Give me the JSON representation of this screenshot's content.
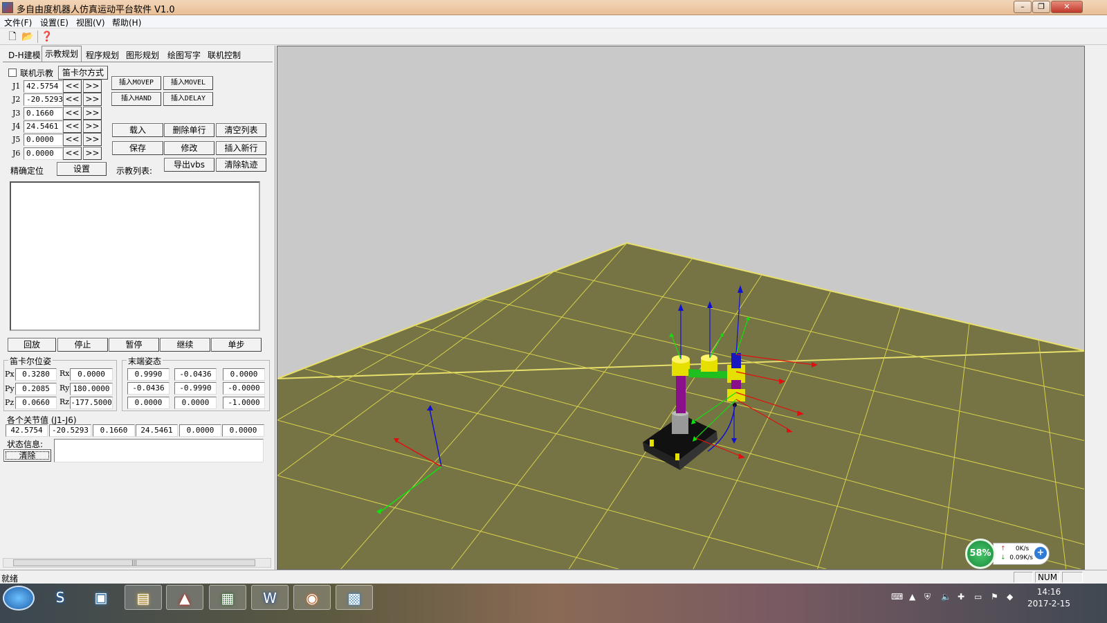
{
  "window": {
    "title": "多自由度机器人仿真运动平台软件 V1.0",
    "controls": {
      "minimize": "–",
      "restore": "❐",
      "close": "✕"
    }
  },
  "menu": [
    "文件(F)",
    "设置(E)",
    "视图(V)",
    "帮助(H)"
  ],
  "toolbar": {
    "icons": [
      "new-file-icon",
      "open-folder-icon",
      "help-icon"
    ],
    "glyphs": [
      "🗋",
      "📂",
      "❓"
    ]
  },
  "tabs": [
    "D-H建模",
    "示教规划",
    "程序规划",
    "图形规划",
    "绘图写字",
    "联机控制"
  ],
  "active_tab": "示教规划",
  "teach": {
    "online_checkbox_label": "联机示教",
    "cartesian_button": "笛卡尔方式",
    "joints": [
      {
        "label": "J1",
        "value": "42.5754"
      },
      {
        "label": "J2",
        "value": "-20.5293"
      },
      {
        "label": "J3",
        "value": "0.1660"
      },
      {
        "label": "J4",
        "value": "24.5461"
      },
      {
        "label": "J5",
        "value": "0.0000"
      },
      {
        "label": "J6",
        "value": "0.0000"
      }
    ],
    "dec_label": "<<",
    "inc_label": ">>",
    "precise_label": "精确定位",
    "set_button": "设置",
    "insert_buttons": [
      "插入MOVEP",
      "插入MOVEL",
      "插入HAND",
      "插入DELAY"
    ],
    "list_buttons": [
      "载入",
      "删除单行",
      "清空列表",
      "保存",
      "修改",
      "插入新行"
    ],
    "teach_list_label": "示教列表:",
    "export_button": "导出vbs",
    "clear_track_button": "清除轨迹"
  },
  "playback_buttons": [
    "回放",
    "停止",
    "暂停",
    "继续",
    "单步"
  ],
  "cartesian": {
    "title": "笛卡尔位姿",
    "rows": [
      {
        "p_label": "Px",
        "p_value": "0.3280",
        "r_label": "Rx",
        "r_value": "0.0000"
      },
      {
        "p_label": "Py",
        "p_value": "0.2085",
        "r_label": "Ry",
        "r_value": "180.0000"
      },
      {
        "p_label": "Pz",
        "p_value": "0.0660",
        "r_label": "Rz",
        "r_value": "-177.5000"
      }
    ]
  },
  "end_pose": {
    "title": "末端姿态",
    "matrix": [
      [
        "0.9990",
        "-0.0436",
        "0.0000"
      ],
      [
        "-0.0436",
        "-0.9990",
        "-0.0000"
      ],
      [
        "0.0000",
        "0.0000",
        "-1.0000"
      ]
    ]
  },
  "joint_values": {
    "title": "各个关节值 (J1-J6)",
    "values": [
      "42.5754",
      "-20.5293",
      "0.1660",
      "24.5461",
      "0.0000",
      "0.0000"
    ]
  },
  "status_info": {
    "label": "状态信息:",
    "clear_button": "清除",
    "text": ""
  },
  "network": {
    "percent": "58%",
    "up": "0K/s",
    "down": "0.09K/s",
    "up_arrow": "↑",
    "down_arrow": "↓",
    "plus": "+"
  },
  "statusbar": {
    "ready": "就绪",
    "num": "NUM"
  },
  "taskbar": {
    "apps": [
      {
        "icon": "sogou-icon",
        "glyph": "S"
      },
      {
        "icon": "store-icon",
        "glyph": "▣"
      },
      {
        "icon": "file-explorer-icon",
        "glyph": "▤"
      },
      {
        "icon": "pdf-reader-icon",
        "glyph": "▲"
      },
      {
        "icon": "terminal-icon",
        "glyph": "▦"
      },
      {
        "icon": "word-icon",
        "glyph": "W"
      },
      {
        "icon": "colorful-app-icon",
        "glyph": "◉"
      },
      {
        "icon": "mfc-app-icon",
        "glyph": "▩"
      }
    ],
    "tray_icons": [
      "keyboard-icon",
      "show-hidden-icon",
      "security-shield-icon",
      "volume-icon",
      "addon-icon",
      "network-icon",
      "flag-icon",
      "qq-icon"
    ],
    "tray_glyphs": [
      "⌨",
      "▲",
      "⛨",
      "🔈",
      "✚",
      "▭",
      "⚑",
      "◆"
    ],
    "time": "14:16",
    "date": "2017-2-15"
  },
  "colors": {
    "floor": "#767445",
    "grid": "#d8d24a",
    "viewport_bg": "#c9c9c9",
    "link_yellow": "#e6e000",
    "link_purple": "#8a0f8a",
    "link_green": "#1fbf1f",
    "axis_red": "#e01010",
    "axis_green": "#10e010",
    "axis_blue": "#1010d0"
  }
}
